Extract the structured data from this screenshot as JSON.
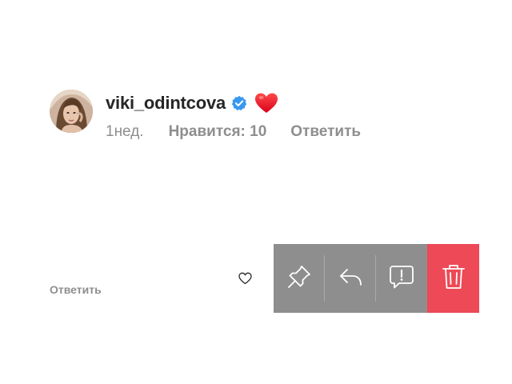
{
  "comment": {
    "username": "viki_odintcova",
    "time": "1нед.",
    "likes": "Нравится: 10",
    "reply": "Ответить",
    "verified_icon": "verified-badge-icon",
    "emoji_icon": "red-heart-emoji-icon"
  },
  "swiped_comment": {
    "reply": "Ответить",
    "like_icon": "heart-outline-icon"
  },
  "actions": [
    {
      "name": "pin",
      "icon": "pin-icon"
    },
    {
      "name": "reply",
      "icon": "reply-arrow-icon"
    },
    {
      "name": "report",
      "icon": "report-icon"
    },
    {
      "name": "delete",
      "icon": "trash-icon"
    }
  ],
  "colors": {
    "action_gray": "#8e8e8e",
    "delete_red": "#ed4956",
    "verified_blue": "#3897f0",
    "text_dark": "#262626",
    "text_muted": "#8e8e8e"
  }
}
